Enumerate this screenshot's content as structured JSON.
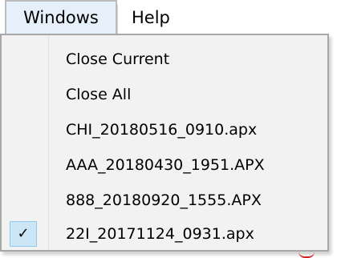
{
  "menubar": {
    "windows_label": "Windows",
    "help_label": "Help"
  },
  "dropdown": {
    "items": [
      {
        "label": "Close Current",
        "checked": false
      },
      {
        "label": "Close All",
        "checked": false
      },
      {
        "label": "CHI_20180516_0910.apx",
        "checked": false
      },
      {
        "label": "AAA_20180430_1951.APX",
        "checked": false
      },
      {
        "label": "888_20180920_1555.APX",
        "checked": false
      },
      {
        "label": "22I_20171124_0931.apx",
        "checked": true
      }
    ],
    "check_glyph": "✓"
  },
  "colors": {
    "menu_background": "#f2f2f2",
    "active_menubar": "#e6f0fb",
    "check_highlight": "#cde6f7"
  }
}
